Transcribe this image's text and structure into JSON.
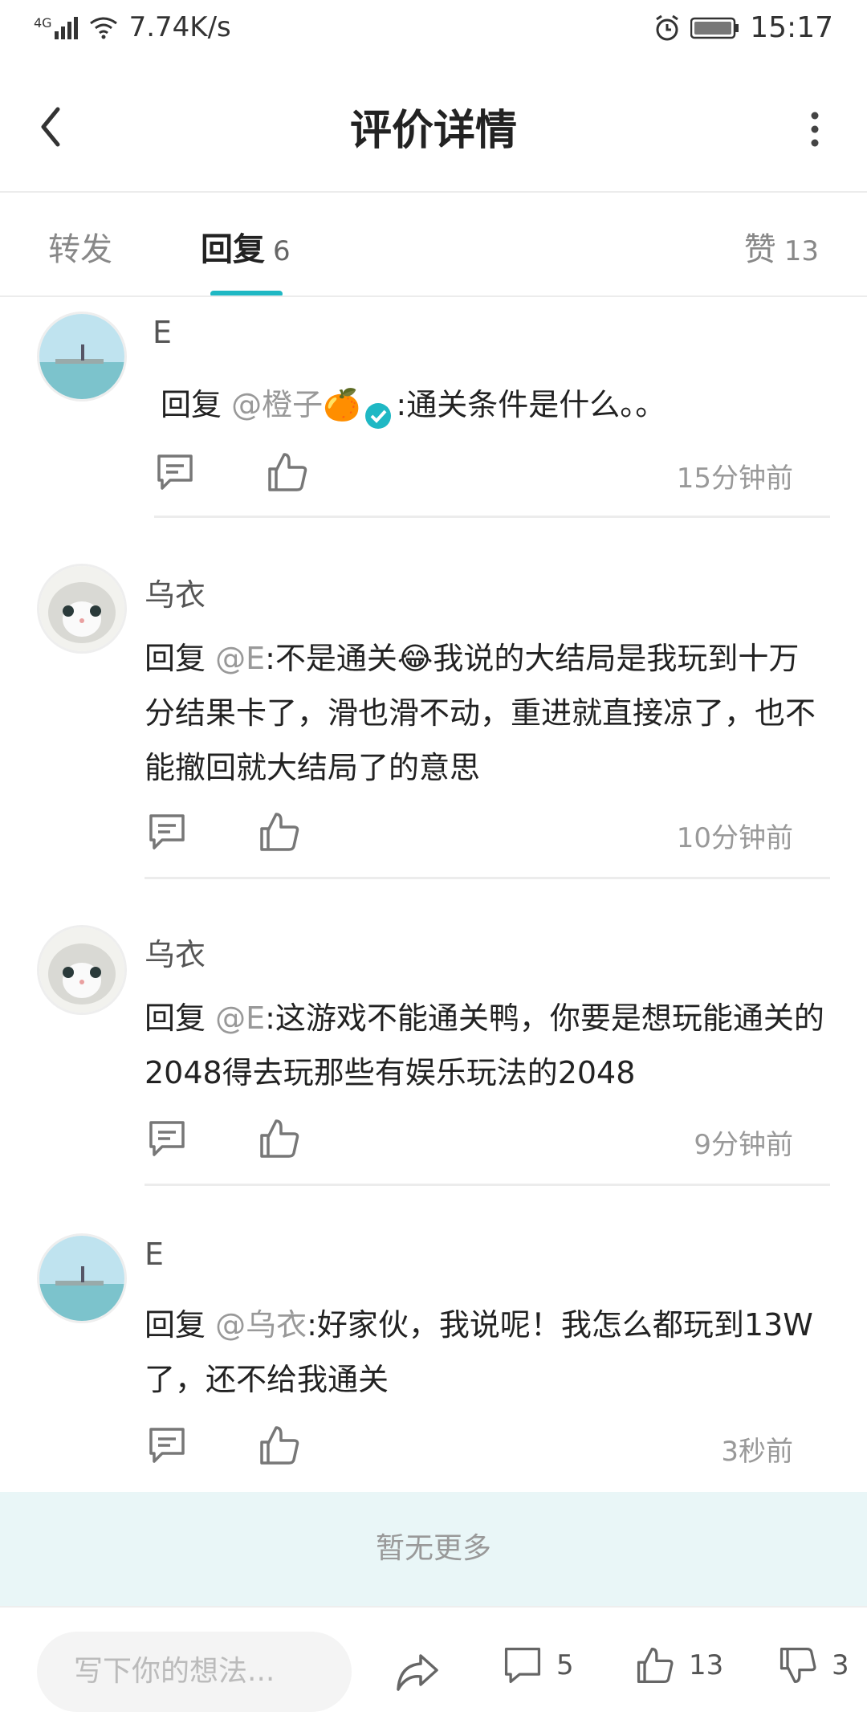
{
  "status_bar": {
    "network": "4G",
    "speed": "7.74K/s",
    "time": "15:17"
  },
  "header": {
    "title": "评价详情"
  },
  "tabs": [
    {
      "label": "转发",
      "count": ""
    },
    {
      "label": "回复",
      "count": "6"
    },
    {
      "label": "赞",
      "count": "13"
    }
  ],
  "comments": [
    {
      "author": "E",
      "prefix": "回复 ",
      "mention": "@橙子🍊",
      "badge": "verified",
      "text": ":通关条件是什么。。",
      "time": "15分钟前"
    },
    {
      "author": "乌衣",
      "prefix": "回复 ",
      "mention": "@E",
      "text": ":不是通关😂我说的大结局是我玩到十万分结果卡了，滑也滑不动，重进就直接凉了，也不能撤回就大结局了的意思",
      "time": "10分钟前"
    },
    {
      "author": "乌衣",
      "prefix": "回复 ",
      "mention": "@E",
      "text": ":这游戏不能通关鸭，你要是想玩能通关的2048得去玩那些有娱乐玩法的2048",
      "time": "9分钟前"
    },
    {
      "author": "E",
      "prefix": "回复 ",
      "mention": "@乌衣",
      "text": ":好家伙，我说呢！我怎么都玩到13W了，还不给我通关",
      "time": "3秒前"
    }
  ],
  "no_more": "暂无更多",
  "bottom_bar": {
    "placeholder": "写下你的想法...",
    "comment_count": "5",
    "like_count": "13",
    "dislike_count": "3"
  },
  "colors": {
    "accent": "#1fb8c4",
    "verified_badge": "#1fb8c4",
    "no_more_bg": "#e9f6f7"
  },
  "icons": [
    "back-arrow-icon",
    "more-vertical-icon",
    "comment-icon",
    "thumb-up-icon",
    "share-icon",
    "thumb-down-icon",
    "verified-icon",
    "alarm-icon",
    "battery-icon",
    "wifi-icon",
    "signal-icon"
  ]
}
